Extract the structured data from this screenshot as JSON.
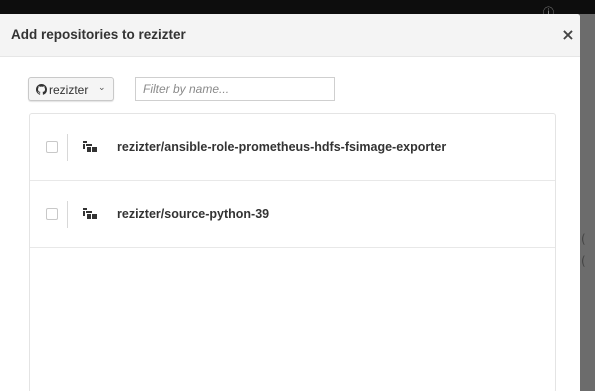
{
  "modal": {
    "title": "Add repositories to rezizter",
    "close_label": "×"
  },
  "toolbar": {
    "org_label": "rezizter",
    "org_caret": "⌄",
    "filter_placeholder": "Filter by name..."
  },
  "repos": [
    {
      "name": "rezizter/ansible-role-prometheus-hdfs-fsimage-exporter"
    },
    {
      "name": "rezizter/source-python-39"
    }
  ],
  "icons": {
    "org_icon": "github-icon",
    "repo_icon": "repository-icon",
    "close_icon": "close-icon"
  },
  "colors": {
    "header_bg": "#f4f4f4",
    "overlay": "#7a7a7a",
    "text": "#333333"
  }
}
